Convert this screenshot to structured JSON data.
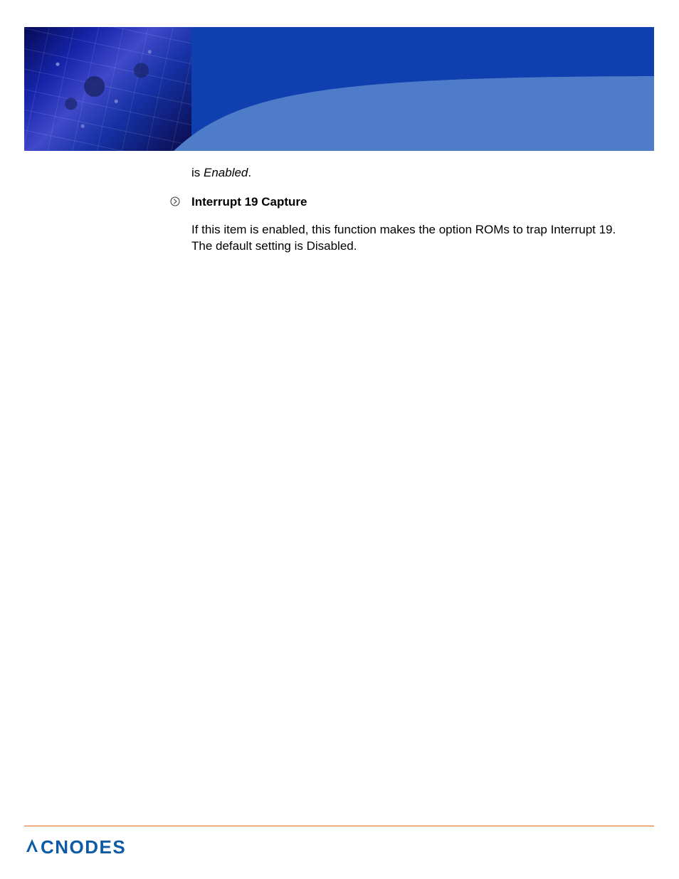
{
  "header": {
    "alt": "Motherboard close-up banner"
  },
  "content": {
    "prev_tail_prefix": "is ",
    "prev_tail_italic": "Enabled",
    "prev_tail_suffix": ".",
    "section": {
      "heading": "Interrupt 19 Capture",
      "body": "If this item is enabled, this function makes the option ROMs to trap Interrupt 19. The default setting is Disabled."
    }
  },
  "footer": {
    "brand": "CNODES"
  },
  "colors": {
    "banner_dark": "#103fb0",
    "banner_curve": "#4e7cc8",
    "rule": "#e0661a",
    "brand": "#0d5aa7"
  }
}
